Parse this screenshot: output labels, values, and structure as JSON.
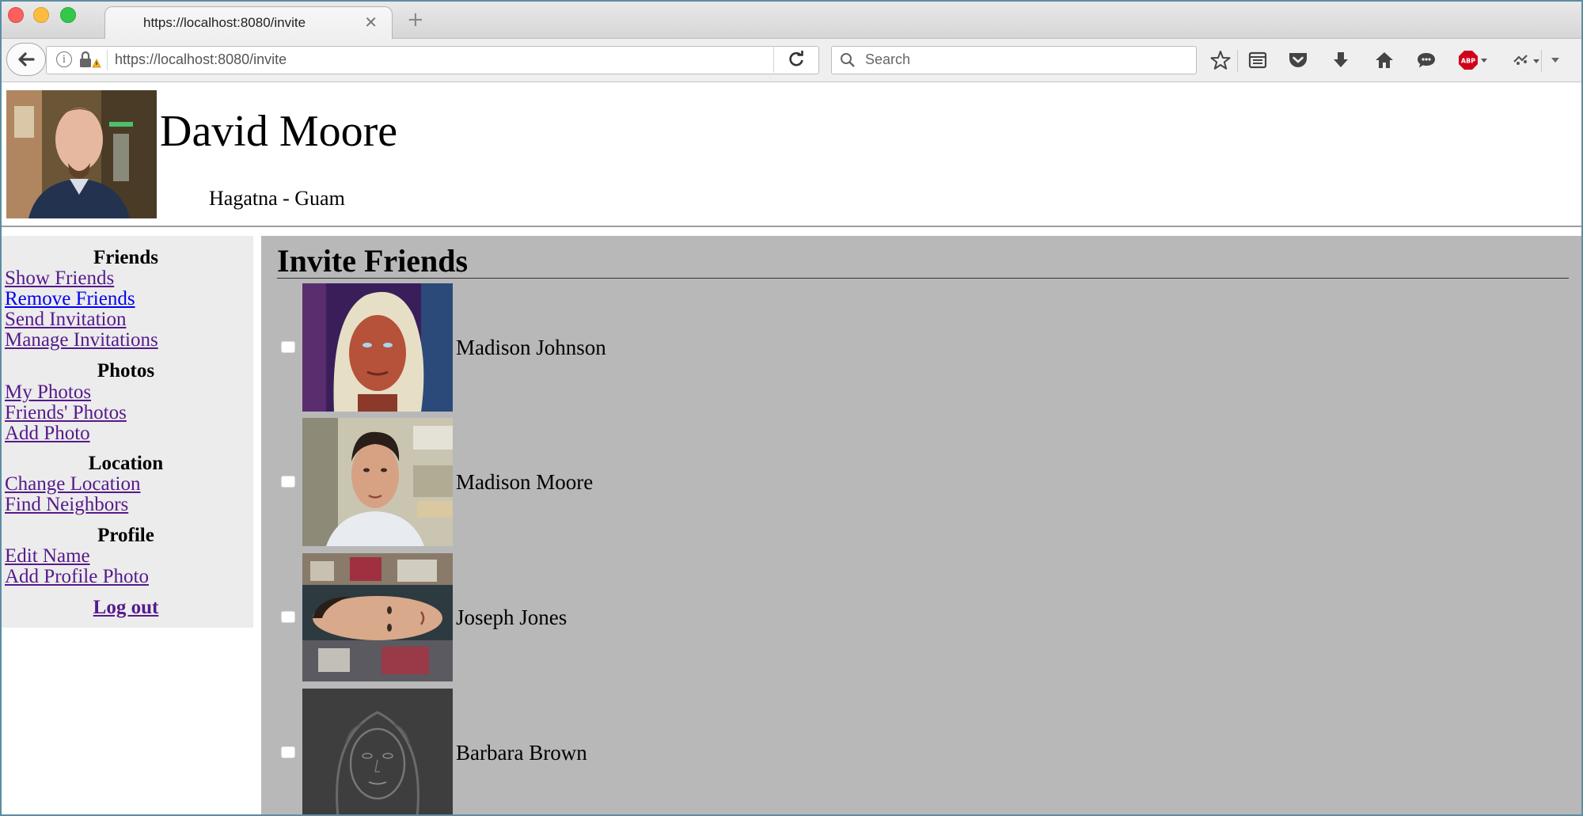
{
  "browser": {
    "tab_title": "https://localhost:8080/invite",
    "url": "https://localhost:8080/invite",
    "search_placeholder": "Search"
  },
  "profile": {
    "name": "David Moore",
    "location": "Hagatna - Guam"
  },
  "sidebar": {
    "sections": [
      {
        "heading": "Friends",
        "links": [
          "Show Friends",
          "Remove Friends",
          "Send Invitation",
          "Manage Invitations"
        ]
      },
      {
        "heading": "Photos",
        "links": [
          "My Photos",
          "Friends' Photos",
          "Add Photo"
        ]
      },
      {
        "heading": "Location",
        "links": [
          "Change Location",
          "Find Neighbors"
        ]
      },
      {
        "heading": "Profile",
        "links": [
          "Edit Name",
          "Add Profile Photo"
        ]
      }
    ],
    "logout": "Log out"
  },
  "main": {
    "title": "Invite Friends",
    "friends": [
      {
        "name": "Madison Johnson"
      },
      {
        "name": "Madison Moore"
      },
      {
        "name": "Joseph Jones"
      },
      {
        "name": "Barbara Brown"
      }
    ]
  }
}
